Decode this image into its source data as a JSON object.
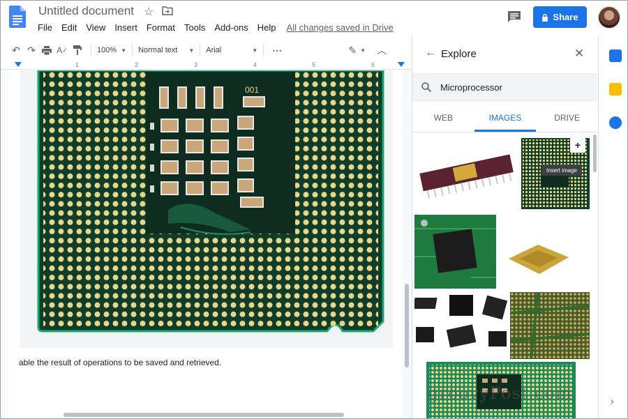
{
  "app": {
    "title": "Untitled document",
    "saved_status": "All changes saved in Drive",
    "share_label": "Share"
  },
  "menu": [
    "File",
    "Edit",
    "View",
    "Insert",
    "Format",
    "Tools",
    "Add-ons",
    "Help"
  ],
  "toolbar": {
    "zoom": "100%",
    "style": "Normal text",
    "font": "Arial"
  },
  "ruler": [
    "1",
    "2",
    "3",
    "4",
    "5",
    "6"
  ],
  "document": {
    "body_text": "able the result of operations to be saved and retrieved."
  },
  "explore": {
    "title": "Explore",
    "query": "Microprocessor",
    "tabs": [
      "WEB",
      "IMAGES",
      "DRIVE"
    ],
    "active_tab": "IMAGES",
    "insert_tooltip": "Insert image",
    "chip_label": "001"
  },
  "watermark": "groovyPost.com",
  "colors": {
    "accent": "#1a73e8",
    "pcb_green": "#0f3d2a",
    "pin_gold": "#e8d68a"
  }
}
